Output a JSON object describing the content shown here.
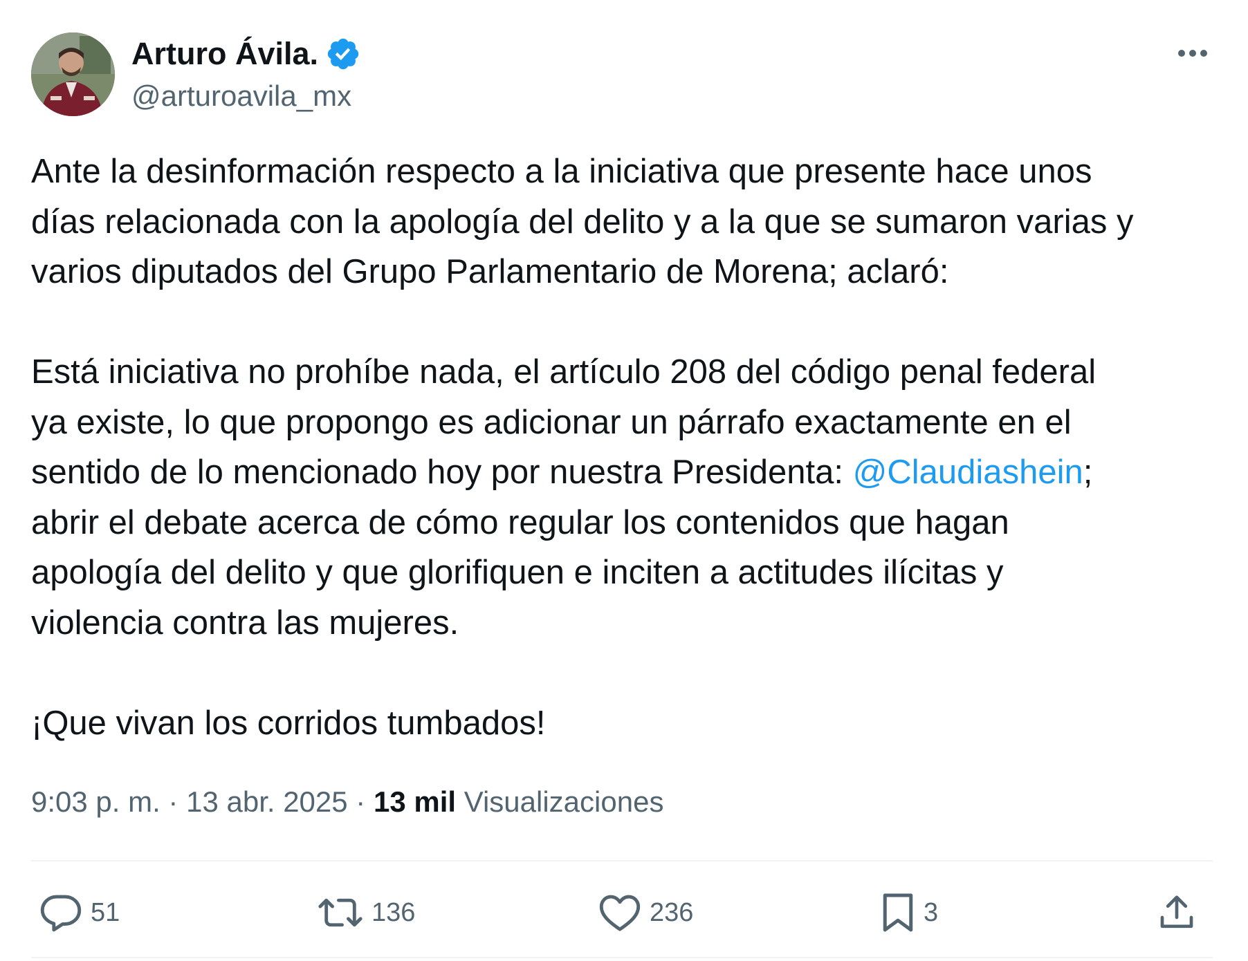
{
  "author": {
    "display_name": "Arturo Ávila.",
    "handle": "@arturoavila_mx",
    "verified_icon": "verified-badge-icon",
    "verified_color": "#1d9bf0"
  },
  "more_icon": "more-horizontal-icon",
  "tweet": {
    "paragraph1": [
      "Ante la desinformación respecto a la iniciativa que presente hace unos",
      "días relacionada con la apología del delito y a la que se sumaron varias y",
      "varios diputados del Grupo Parlamentario de Morena; aclaró:"
    ],
    "paragraph2": {
      "line1": "Está iniciativa no prohíbe nada, el artículo 208 del código penal federal",
      "line2": "ya existe, lo que propongo es adicionar un párrafo exactamente en el",
      "line3_before": "sentido de lo mencionado hoy por nuestra Presidenta: ",
      "mention": "@Claudiashein",
      "line3_after": ";",
      "line4": "abrir el debate acerca de cómo regular los contenidos que hagan",
      "line5": "apología del delito y que glorifiquen e inciten a actitudes ilícitas y",
      "line6": "violencia contra las mujeres."
    },
    "paragraph3": "¡Que vivan los corridos tumbados!",
    "mention_color": "#1d9bf0"
  },
  "meta": {
    "time": "9:03 p. m.",
    "separator": " · ",
    "date": "13 abr. 2025",
    "views_count": "13 mil",
    "views_label": " Visualizaciones"
  },
  "actions": {
    "replies": {
      "icon": "reply-icon",
      "count": "51"
    },
    "reposts": {
      "icon": "repost-icon",
      "count": "136"
    },
    "likes": {
      "icon": "heart-icon",
      "count": "236"
    },
    "bookmarks": {
      "icon": "bookmark-icon",
      "count": "3"
    },
    "share": {
      "icon": "share-icon"
    }
  },
  "colors": {
    "text": "#0f1419",
    "secondary": "#536471",
    "divider": "#eff3f4"
  }
}
